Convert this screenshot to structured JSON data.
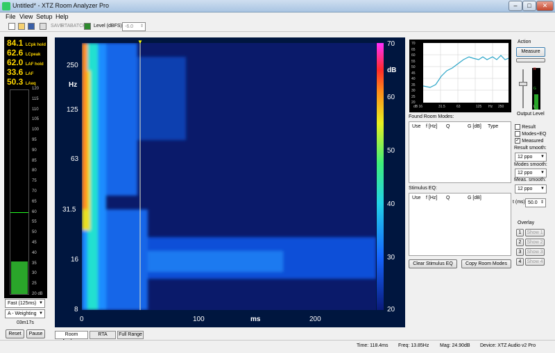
{
  "window": {
    "title": "Untitled* - XTZ Room Analyzer Pro"
  },
  "menu": {
    "items": [
      "File",
      "View",
      "Setup",
      "Help"
    ]
  },
  "toolbar": {
    "disabled_labels": [
      "SAVE",
      "RTA",
      "BATCH"
    ],
    "level_label": "Level (dBFS)",
    "level_value": "-6.0"
  },
  "meters": {
    "values": [
      {
        "value": "84.1",
        "label": "LCpk hold"
      },
      {
        "value": "62.6",
        "label": "LCpeak"
      },
      {
        "value": "62.0",
        "label": "LAF hold"
      },
      {
        "value": "33.6",
        "label": "LAF"
      },
      {
        "value": "50.3",
        "label": "LAeq"
      }
    ],
    "scale": [
      "120",
      "115",
      "110",
      "105",
      "100",
      "95",
      "90",
      "85",
      "80",
      "75",
      "70",
      "65",
      "60",
      "55",
      "50",
      "45",
      "40",
      "35",
      "30",
      "25",
      "20 dB"
    ],
    "level_fraction": 0.16,
    "hold_fraction": 0.4,
    "time_weighting": "Fast (125ms)",
    "freq_weighting": "A - Weighting",
    "elapsed": "03m17s",
    "reset_label": "Reset",
    "pause_label": "Pause"
  },
  "plot": {
    "y_unit": "Hz",
    "y_ticks": [
      "250",
      "125",
      "63",
      "31.5",
      "16",
      "8"
    ],
    "x_unit": "ms",
    "x_ticks": [
      "0",
      "100",
      "200"
    ],
    "colorbar_unit": "dB",
    "colorbar_ticks": [
      "70",
      "60",
      "50",
      "40",
      "30",
      "20"
    ]
  },
  "mini_chart": {
    "y_ticks": [
      "70",
      "65",
      "60",
      "55",
      "50",
      "45",
      "40",
      "35",
      "30",
      "25",
      "20"
    ],
    "x_ticks": [
      "dB 16",
      "31.5",
      "63",
      "125",
      "Hz",
      "250"
    ]
  },
  "action": {
    "title": "Action",
    "measure_label": "Measure",
    "output_level_label": "Output Level",
    "slider_letters": [
      "R",
      "G",
      "L"
    ]
  },
  "found_modes": {
    "title": "Found Room Modes:",
    "columns": [
      "Use",
      "f [Hz]",
      "Q",
      "G [dB]",
      "Type"
    ]
  },
  "stimulus_eq": {
    "title": "Stimulus EQ:",
    "columns": [
      "Use",
      "f [Hz]",
      "Q",
      "G [dB]"
    ]
  },
  "options": {
    "checkboxes": [
      {
        "label": "Result",
        "checked": false
      },
      {
        "label": "Modes+EQ",
        "checked": false
      },
      {
        "label": "Measured",
        "checked": true
      }
    ],
    "result_smooth_label": "Result smooth:",
    "result_smooth_value": "12 ppo",
    "modes_smooth_label": "Modes smooth:",
    "modes_smooth_value": "12 ppo",
    "meas_smooth_label": "Meas. smooth:",
    "meas_smooth_value": "12 ppo",
    "t_label": "t (ms)",
    "t_value": "50.0"
  },
  "buttons": {
    "clear_eq": "Clear Stimulus EQ",
    "copy_modes": "Copy Room Modes"
  },
  "overlay": {
    "title": "Overlay",
    "items": [
      {
        "num": "1",
        "label": "Show 1"
      },
      {
        "num": "2",
        "label": "Show 2"
      },
      {
        "num": "3",
        "label": "Show 3"
      },
      {
        "num": "4",
        "label": "Show 4"
      }
    ]
  },
  "tabs": [
    "Room Analyzer",
    "RTA",
    "Full Range"
  ],
  "status": {
    "time": "Time: 118.4ms",
    "freq": "Freq: 13.85Hz",
    "mag": "Mag: 24.90dB",
    "device": "Device: XTZ Audio v2 Pro"
  }
}
